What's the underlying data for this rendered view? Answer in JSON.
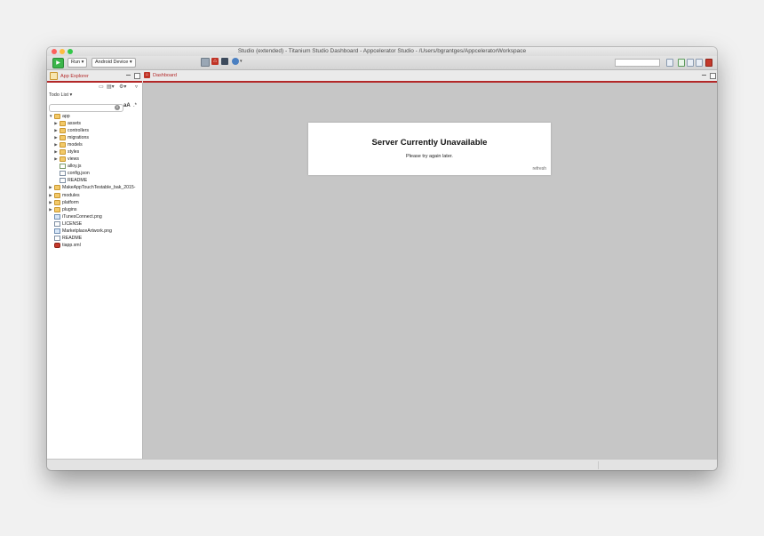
{
  "window": {
    "title": "Studio (extended) - Titanium Studio Dashboard - Appcelerator Studio - /Users/bgrantges/AppceleratorWorkspace"
  },
  "toolbar": {
    "run_icon": "play-icon",
    "run_label": "Run",
    "target_label": "Android Device",
    "colors": {
      "run_green": "#3bb54a",
      "accent_red": "#b32828"
    }
  },
  "left_panel": {
    "tab_label": "App Explorer",
    "todo_label": "Todo List",
    "filter_value": "",
    "case_toggle": "aA",
    "regex_toggle": ".*",
    "tree": [
      {
        "label": "app",
        "depth": 0,
        "type": "folder",
        "expanded": true
      },
      {
        "label": "assets",
        "depth": 1,
        "type": "folder",
        "expanded": false
      },
      {
        "label": "controllers",
        "depth": 1,
        "type": "folder",
        "expanded": false
      },
      {
        "label": "migrations",
        "depth": 1,
        "type": "folder",
        "expanded": false
      },
      {
        "label": "models",
        "depth": 1,
        "type": "folder",
        "expanded": false
      },
      {
        "label": "styles",
        "depth": 1,
        "type": "folder",
        "expanded": false
      },
      {
        "label": "views",
        "depth": 1,
        "type": "folder",
        "expanded": false
      },
      {
        "label": "alloy.js",
        "depth": 1,
        "type": "jsfile"
      },
      {
        "label": "config.json",
        "depth": 1,
        "type": "file"
      },
      {
        "label": "README",
        "depth": 1,
        "type": "file"
      },
      {
        "label": "MakeAppTouchTestable_bak_2015-",
        "depth": 0,
        "type": "folder",
        "expanded": false
      },
      {
        "label": "modules",
        "depth": 0,
        "type": "folder",
        "expanded": false
      },
      {
        "label": "platform",
        "depth": 0,
        "type": "folder",
        "expanded": false
      },
      {
        "label": "plugins",
        "depth": 0,
        "type": "folder",
        "expanded": false
      },
      {
        "label": "iTunesConnect.png",
        "depth": 0,
        "type": "imgfile"
      },
      {
        "label": "LICENSE",
        "depth": 0,
        "type": "file"
      },
      {
        "label": "MarketplaceArtwork.png",
        "depth": 0,
        "type": "imgfile"
      },
      {
        "label": "README",
        "depth": 0,
        "type": "file"
      },
      {
        "label": "tiapp.xml",
        "depth": 0,
        "type": "xmlfile"
      }
    ]
  },
  "editor": {
    "tab_label": "Dashboard",
    "card_title": "Server Currently Unavailable",
    "card_message": "Please try again later.",
    "refresh_link": "refresh"
  }
}
